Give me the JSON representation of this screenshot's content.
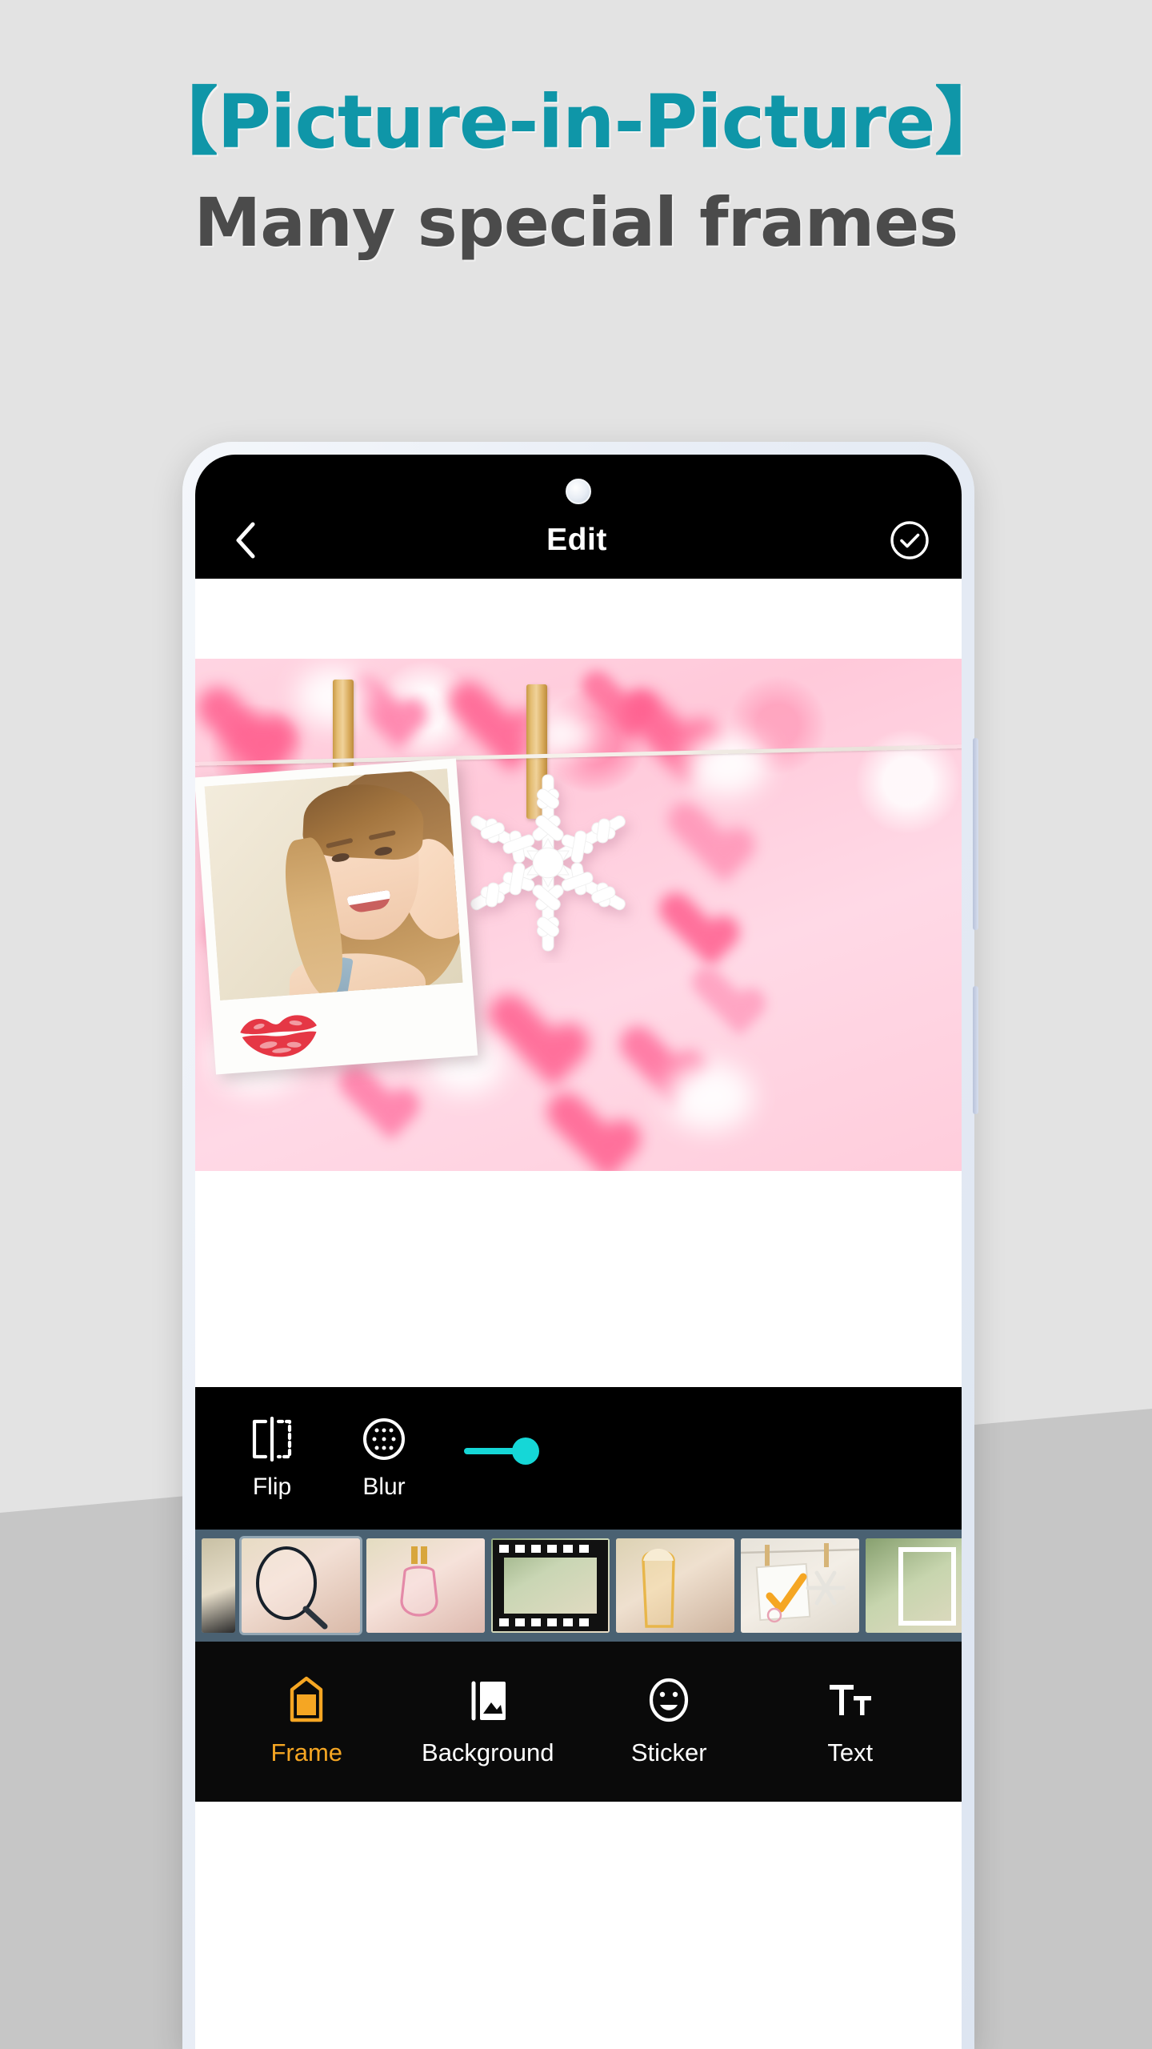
{
  "promo": {
    "headline": "【Picture-in-Picture】",
    "subhead": "Many special frames",
    "headline_color": "#0f96a8",
    "subhead_color": "#4b4b4b",
    "background_color": "#e3e3e3",
    "background_band_color": "#c6c6c6"
  },
  "app": {
    "header": {
      "title": "Edit",
      "back_icon": "chevron-left-icon",
      "done_icon": "check-circle-icon"
    },
    "canvas": {
      "frame_name": "clothesline-polaroid-hearts",
      "background_theme": "pink-hearts",
      "stickers": [
        "snowflake",
        "lipstick-kiss"
      ],
      "clothespins": 2
    },
    "edit_toolbar": {
      "tools": [
        {
          "label": "Flip",
          "icon": "flip-horizontal-icon"
        },
        {
          "label": "Blur",
          "icon": "blur-circle-icon"
        }
      ],
      "slider": {
        "name": "blur-intensity-slider",
        "value": 14,
        "min": 0,
        "max": 100,
        "accent_color": "#15d7d7"
      }
    },
    "frame_strip": {
      "strip_background": "#4a6172",
      "selected_index": 1,
      "thumbnails": [
        {
          "name": "frame-thumb-1",
          "style": "partial-left"
        },
        {
          "name": "frame-thumb-2",
          "style": "magnifier-circle"
        },
        {
          "name": "frame-thumb-3",
          "style": "perfume-bottle"
        },
        {
          "name": "frame-thumb-4",
          "style": "film-strip"
        },
        {
          "name": "frame-thumb-5",
          "style": "beer-glass"
        },
        {
          "name": "frame-thumb-6",
          "style": "clothesline-snowflake"
        },
        {
          "name": "frame-thumb-7",
          "style": "white-border-rect"
        }
      ]
    },
    "bottom_nav": {
      "active_index": 0,
      "active_color": "#f5a623",
      "items": [
        {
          "label": "Frame",
          "icon": "frame-icon"
        },
        {
          "label": "Background",
          "icon": "image-stack-icon"
        },
        {
          "label": "Sticker",
          "icon": "smiley-icon"
        },
        {
          "label": "Text",
          "icon": "text-tt-icon"
        }
      ]
    }
  }
}
